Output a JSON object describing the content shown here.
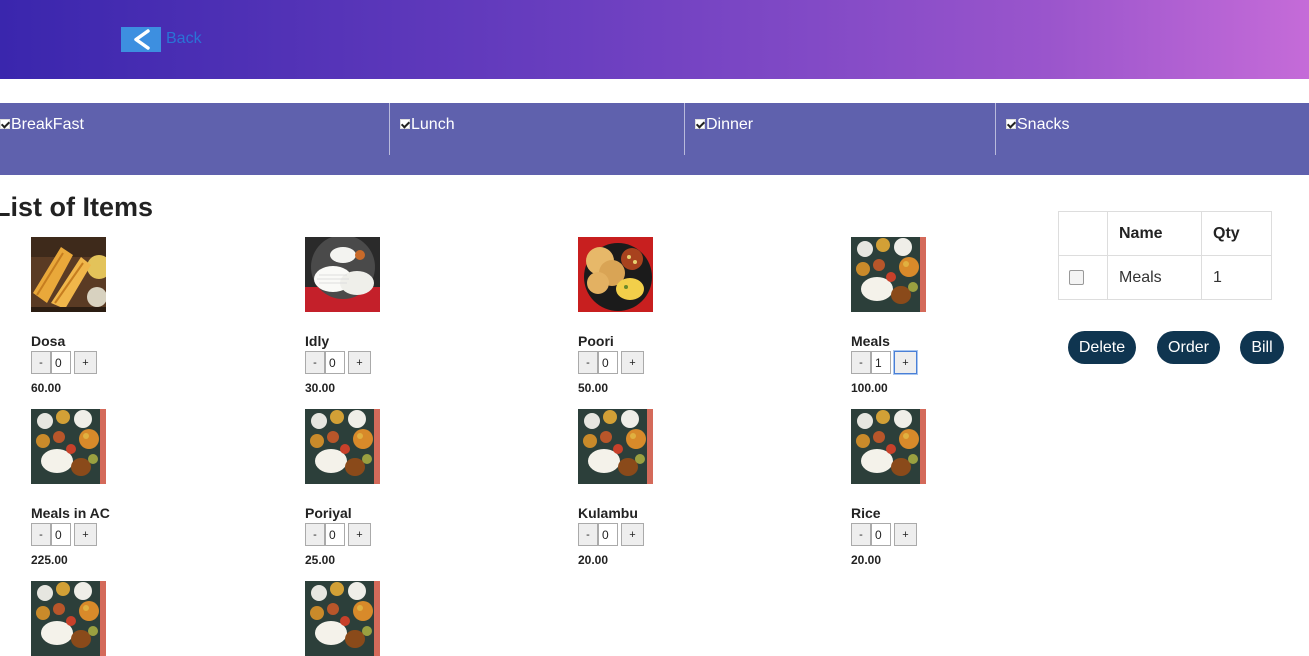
{
  "header": {
    "back_label": "Back"
  },
  "categories": [
    {
      "label": "BreakFast",
      "checked": true
    },
    {
      "label": "Lunch",
      "checked": true
    },
    {
      "label": "Dinner",
      "checked": true
    },
    {
      "label": "Snacks",
      "checked": true
    }
  ],
  "main": {
    "title": "List of Items"
  },
  "items": [
    {
      "name": "Dosa",
      "qty": "0",
      "price": "60.00",
      "image": "dosa"
    },
    {
      "name": "Idly",
      "qty": "0",
      "price": "30.00",
      "image": "idly"
    },
    {
      "name": "Poori",
      "qty": "0",
      "price": "50.00",
      "image": "poori"
    },
    {
      "name": "Meals",
      "qty": "1",
      "price": "100.00",
      "image": "meals-thali"
    },
    {
      "name": "Meals in AC",
      "qty": "0",
      "price": "225.00",
      "image": "meals-thali"
    },
    {
      "name": "Poriyal",
      "qty": "0",
      "price": "25.00",
      "image": "meals-thali"
    },
    {
      "name": "Kulambu",
      "qty": "0",
      "price": "20.00",
      "image": "meals-thali"
    },
    {
      "name": "Rice",
      "qty": "0",
      "price": "20.00",
      "image": "meals-thali"
    }
  ],
  "qty_controls": {
    "minus": "-",
    "plus": "+"
  },
  "cart": {
    "headers": [
      "",
      "Name",
      "Qty"
    ],
    "rows": [
      {
        "name": "Meals",
        "qty": "1"
      }
    ]
  },
  "actions": {
    "delete": "Delete",
    "order": "Order",
    "bill": "Bill"
  },
  "colors": {
    "header_start": "#3a26ad",
    "header_end": "#c56bd8",
    "category_bar": "#5f61ad",
    "action_button": "#0f3550"
  }
}
